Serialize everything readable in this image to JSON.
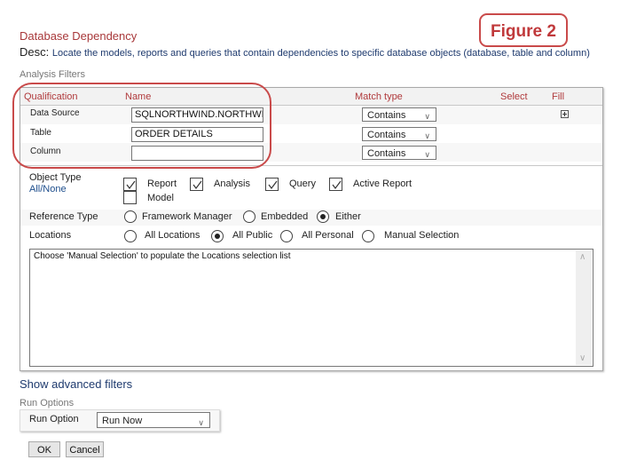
{
  "page": {
    "title": "Database Dependency",
    "desc_prefix": "Desc:",
    "desc_text": "Locate the models, reports and queries that contain dependencies to specific database objects (database, table and column)",
    "figure_badge": "Figure 2"
  },
  "analysis_filters": {
    "section_label": "Analysis Filters",
    "columns": [
      "Qualification",
      "Name",
      "Match type",
      "Select",
      "Fill"
    ],
    "rows": [
      {
        "qualification": "Data Source",
        "name_value": "SQLNORTHWIND.NORTHWIN",
        "match_type": "Contains",
        "fill_icon": "plus-box-icon"
      },
      {
        "qualification": "Table",
        "name_value": "ORDER DETAILS",
        "match_type": "Contains"
      },
      {
        "qualification": "Column",
        "name_value": "",
        "match_type": "Contains"
      }
    ]
  },
  "object_type": {
    "label": "Object Type",
    "all_none_link": "All/None",
    "options": [
      {
        "label": "Report",
        "checked": true
      },
      {
        "label": "Analysis",
        "checked": true
      },
      {
        "label": "Query",
        "checked": true
      },
      {
        "label": "Active Report",
        "checked": true
      },
      {
        "label": "Model",
        "checked": false
      }
    ]
  },
  "reference_type": {
    "label": "Reference Type",
    "options": [
      {
        "label": "Framework Manager",
        "selected": false
      },
      {
        "label": "Embedded",
        "selected": false
      },
      {
        "label": "Either",
        "selected": true
      }
    ]
  },
  "locations": {
    "label": "Locations",
    "options": [
      {
        "label": "All Locations",
        "selected": false
      },
      {
        "label": "All Public",
        "selected": true
      },
      {
        "label": "All Personal",
        "selected": false
      },
      {
        "label": "Manual Selection",
        "selected": false
      }
    ],
    "list_hint": "Choose 'Manual Selection' to populate the Locations selection list"
  },
  "advanced_link": "Show advanced filters",
  "run_options": {
    "section_label": "Run Options",
    "label": "Run Option",
    "value": "Run Now"
  },
  "buttons": {
    "ok": "OK",
    "cancel": "Cancel"
  },
  "colors": {
    "title_red": "#a8383a",
    "header_red": "#b03a3c",
    "annotation_red": "#c94a4a",
    "link_blue": "#1e4e8c"
  }
}
